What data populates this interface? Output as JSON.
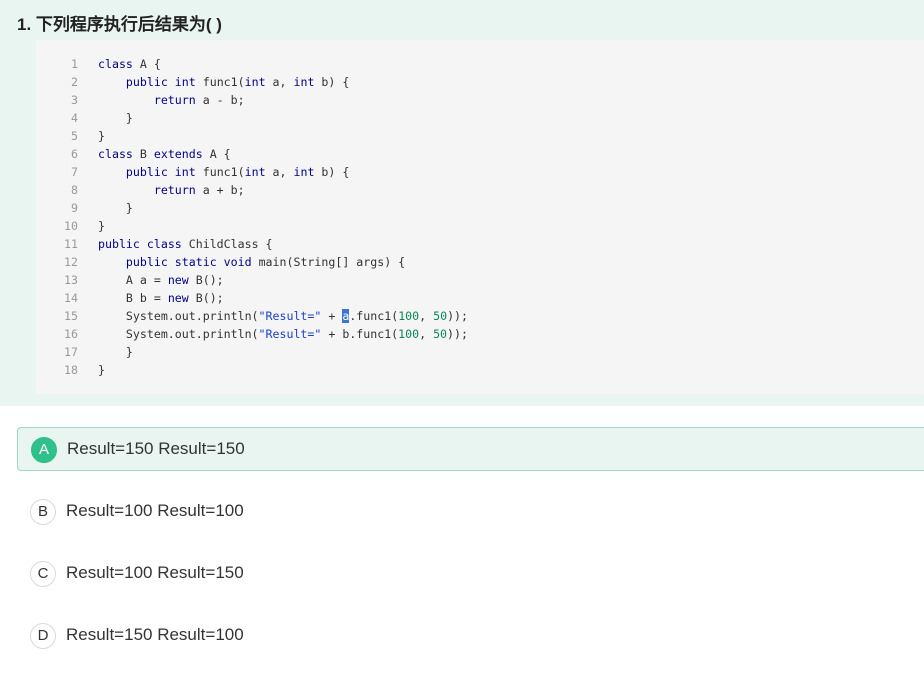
{
  "question": {
    "title": "1. 下列程序执行后结果为( )"
  },
  "code": {
    "line_numbers": [
      "1",
      "2",
      "3",
      "4",
      "5",
      "6",
      "7",
      "8",
      "9",
      "10",
      "11",
      "12",
      "13",
      "14",
      "15",
      "16",
      "17",
      "18"
    ],
    "lines": [
      [
        {
          "t": "class",
          "c": "kw"
        },
        {
          "t": " A {"
        }
      ],
      [
        {
          "t": "    "
        },
        {
          "t": "public",
          "c": "kw"
        },
        {
          "t": " "
        },
        {
          "t": "int",
          "c": "kw"
        },
        {
          "t": " func1("
        },
        {
          "t": "int",
          "c": "kw"
        },
        {
          "t": " a, "
        },
        {
          "t": "int",
          "c": "kw"
        },
        {
          "t": " b) {"
        }
      ],
      [
        {
          "t": "        "
        },
        {
          "t": "return",
          "c": "kw"
        },
        {
          "t": " a - b;"
        }
      ],
      [
        {
          "t": "    }"
        }
      ],
      [
        {
          "t": "}"
        }
      ],
      [
        {
          "t": "class",
          "c": "kw"
        },
        {
          "t": " B "
        },
        {
          "t": "extends",
          "c": "kw"
        },
        {
          "t": " A {"
        }
      ],
      [
        {
          "t": "    "
        },
        {
          "t": "public",
          "c": "kw"
        },
        {
          "t": " "
        },
        {
          "t": "int",
          "c": "kw"
        },
        {
          "t": " func1("
        },
        {
          "t": "int",
          "c": "kw"
        },
        {
          "t": " a, "
        },
        {
          "t": "int",
          "c": "kw"
        },
        {
          "t": " b) {"
        }
      ],
      [
        {
          "t": "        "
        },
        {
          "t": "return",
          "c": "kw"
        },
        {
          "t": " a + b;"
        }
      ],
      [
        {
          "t": "    }"
        }
      ],
      [
        {
          "t": "}"
        }
      ],
      [
        {
          "t": "public",
          "c": "kw"
        },
        {
          "t": " "
        },
        {
          "t": "class",
          "c": "kw"
        },
        {
          "t": " ChildClass {"
        }
      ],
      [
        {
          "t": "    "
        },
        {
          "t": "public",
          "c": "kw"
        },
        {
          "t": " "
        },
        {
          "t": "static",
          "c": "kw"
        },
        {
          "t": " "
        },
        {
          "t": "void",
          "c": "kw"
        },
        {
          "t": " main(String[] args) {"
        }
      ],
      [
        {
          "t": "    A a = "
        },
        {
          "t": "new",
          "c": "kw"
        },
        {
          "t": " B();"
        }
      ],
      [
        {
          "t": "    B b = "
        },
        {
          "t": "new",
          "c": "kw"
        },
        {
          "t": " B();"
        }
      ],
      [
        {
          "t": "    System.out.println("
        },
        {
          "t": "\"Result=\"",
          "c": "str"
        },
        {
          "t": " + "
        },
        {
          "t": "a",
          "c": "sel"
        },
        {
          "t": ".func1("
        },
        {
          "t": "100",
          "c": "num"
        },
        {
          "t": ", "
        },
        {
          "t": "50",
          "c": "num"
        },
        {
          "t": "));"
        }
      ],
      [
        {
          "t": "    System.out.println("
        },
        {
          "t": "\"Result=\"",
          "c": "str"
        },
        {
          "t": " + b.func1("
        },
        {
          "t": "100",
          "c": "num"
        },
        {
          "t": ", "
        },
        {
          "t": "50",
          "c": "num"
        },
        {
          "t": "));"
        }
      ],
      [
        {
          "t": "    }"
        }
      ],
      [
        {
          "t": "}"
        }
      ]
    ]
  },
  "options": [
    {
      "letter": "A",
      "text": "Result=150 Result=150",
      "selected": true
    },
    {
      "letter": "B",
      "text": "Result=100 Result=100",
      "selected": false
    },
    {
      "letter": "C",
      "text": "Result=100 Result=150",
      "selected": false
    },
    {
      "letter": "D",
      "text": "Result=150 Result=100",
      "selected": false
    }
  ],
  "colors": {
    "question_bg": "#e9f5f1",
    "code_bg": "#f5f5f5",
    "accent_green": "#2fc08c",
    "keyword": "#00008b",
    "string": "#1a3fd1",
    "number": "#098658",
    "selection": "#3875d7"
  }
}
